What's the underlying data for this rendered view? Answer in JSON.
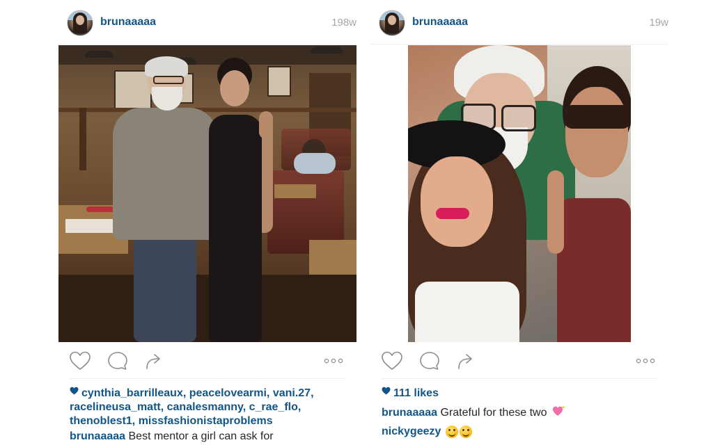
{
  "posts": [
    {
      "username": "brunaaaaa",
      "time": "198w",
      "likers": [
        "cynthia_barrilleaux",
        "peacelovearmi",
        "vani.27",
        "racelineusa_matt",
        "canalesmanny",
        "c_rae_flo",
        "thenoblest1",
        "missfashionistaproblems"
      ],
      "caption": {
        "author": "brunaaaaa",
        "text": "Best mentor a girl can ask for"
      }
    },
    {
      "username": "brunaaaaa",
      "time": "19w",
      "likes_text": "111 likes",
      "caption": {
        "author": "brunaaaaa",
        "text": "Grateful for these two"
      },
      "comment": {
        "author": "nickygeezy"
      }
    }
  ],
  "colors": {
    "link": "#125688",
    "muted": "#a5a7aa",
    "divider": "#efefef",
    "text": "#262626"
  },
  "icons": {
    "like": "heart-outline-icon",
    "comment": "speech-bubble-icon",
    "share": "share-arrow-icon",
    "more": "ellipsis-icon"
  }
}
